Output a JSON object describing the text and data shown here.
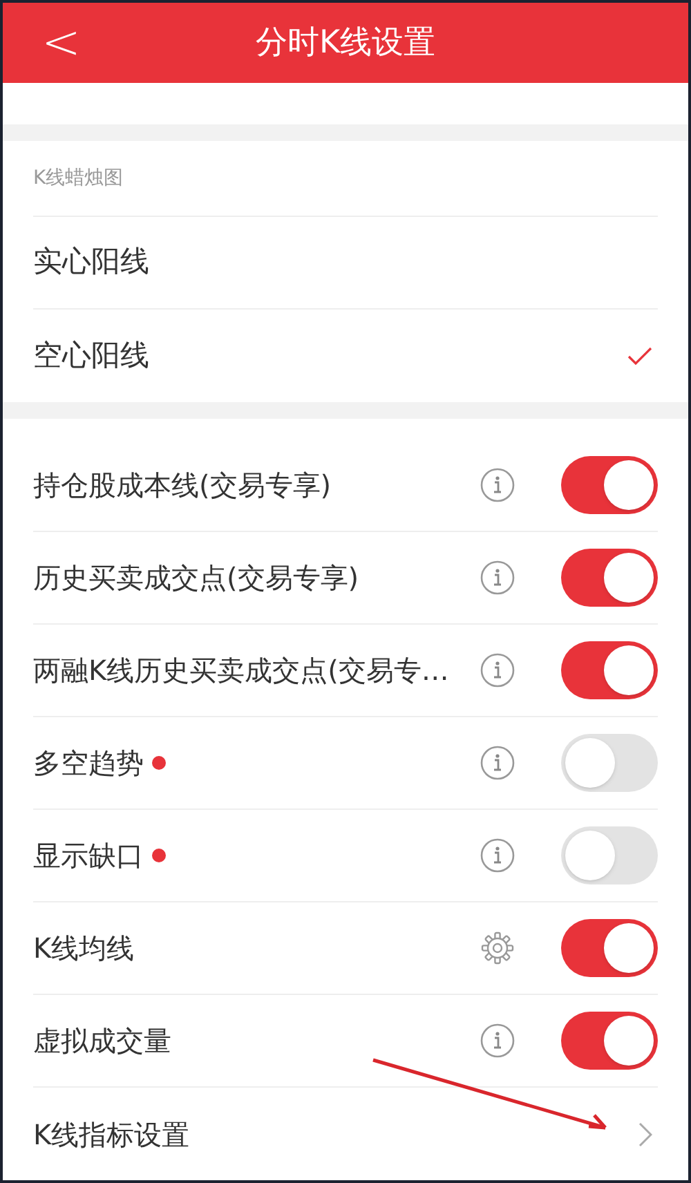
{
  "header": {
    "back_icon": "<",
    "title": "分时K线设置"
  },
  "candle_section": {
    "label": "K线蜡烛图",
    "options": [
      {
        "label": "实心阳线",
        "selected": false
      },
      {
        "label": "空心阳线",
        "selected": true
      }
    ]
  },
  "settings": [
    {
      "kind": "info",
      "label": "持仓股成本线(交易专享)",
      "on": true,
      "new": false
    },
    {
      "kind": "info",
      "label": "历史买卖成交点(交易专享)",
      "on": true,
      "new": false
    },
    {
      "kind": "info",
      "label": "两融K线历史买卖成交点(交易专…",
      "on": true,
      "new": false
    },
    {
      "kind": "info",
      "label": "多空趋势",
      "on": false,
      "new": true
    },
    {
      "kind": "info",
      "label": "显示缺口",
      "on": false,
      "new": true
    },
    {
      "kind": "gear",
      "label": "K线均线",
      "on": true,
      "new": false
    },
    {
      "kind": "info",
      "label": "虚拟成交量",
      "on": true,
      "new": false
    },
    {
      "kind": "link",
      "label": "K线指标设置"
    }
  ]
}
